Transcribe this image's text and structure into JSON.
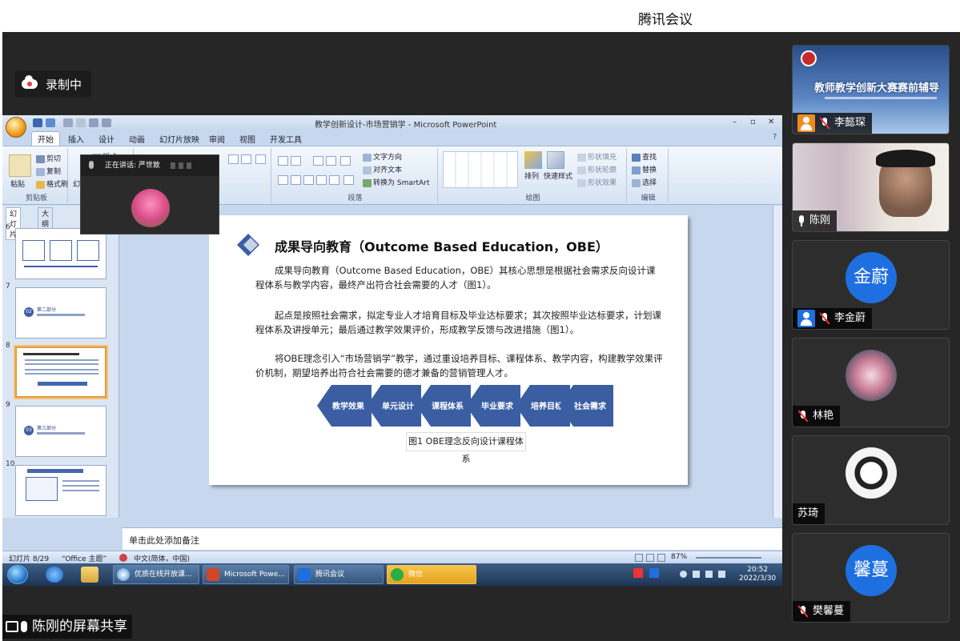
{
  "app": {
    "title": "腾讯会议"
  },
  "recording": {
    "label": "录制中"
  },
  "ppt": {
    "window_title": "教学创新设计-市场营销学 - Microsoft PowerPoint",
    "tabs": [
      "开始",
      "插入",
      "设计",
      "动画",
      "幻灯片放映",
      "审阅",
      "视图",
      "开发工具"
    ],
    "ribbon": {
      "clipboard": {
        "paste": "粘贴",
        "cut": "剪切",
        "copy": "复制",
        "format_painter": "格式刷",
        "group": "剪贴板"
      },
      "slides_btn": "幻",
      "new_slide_hint": "版式",
      "paragraph": {
        "group": "段落",
        "text_direction": "文字方向",
        "align_text": "对齐文本",
        "smartart": "转换为 SmartArt"
      },
      "drawing": {
        "group": "绘图",
        "arrange": "排列",
        "quick_styles": "快速样式",
        "shape_fill": "形状填充",
        "shape_outline": "形状轮廓",
        "shape_effects": "形状效果"
      },
      "editing": {
        "group": "编辑",
        "find": "查找",
        "replace": "替换",
        "select": "选择"
      }
    },
    "thumb_tabs": [
      "幻灯片",
      "大纲"
    ],
    "thumbnails": [
      {
        "num": "6"
      },
      {
        "num": "7",
        "circle": "02",
        "text": "第二部分"
      },
      {
        "num": "8"
      },
      {
        "num": "9",
        "circle": "03",
        "text": "第三部分"
      },
      {
        "num": "10"
      }
    ],
    "slide": {
      "heading": "成果导向教育（Outcome Based Education，OBE）",
      "para1": "成果导向教育（Outcome Based Education，OBE）其核心思想是根据社会需求反向设计课程体系与教学内容，最终产出符合社会需要的人才（图1）。",
      "para2": "起点是按照社会需求，拟定专业人才培育目标及毕业达标要求；其次按照毕业达标要求，计划课程体系及讲授单元；最后通过教学效果评价，形成教学反馈与改进措施（图1）。",
      "para3": "将OBE理念引入“市场营销学”教学，通过重设培养目标、课程体系、教学内容，构建教学效果评价机制，期望培养出符合社会需要的德才兼备的营销管理人才。",
      "arrows": [
        "教学效果",
        "单元设计",
        "课程体系",
        "毕业要求",
        "培养目标",
        "社会需求"
      ],
      "caption": "图1  OBE理念反向设计课程体系"
    },
    "notes_placeholder": "单击此处添加备注",
    "status": {
      "slide_counter": "幻灯片 8/29",
      "theme": "“Office 主题”",
      "language": "中文(简体，中国)",
      "zoom": "87%"
    }
  },
  "taskbar": {
    "items": [
      "优质在线开放课...",
      "Microsoft Powe...",
      "腾讯会议",
      "微信"
    ],
    "time": "20:52",
    "date": "2022/3/30"
  },
  "speaking": {
    "label": "正在讲话: 严世致"
  },
  "share_label": "陈刚的屏幕共享",
  "participants": [
    {
      "name": "李懿琛",
      "poster_title": "教师教学创新大赛赛前辅导"
    },
    {
      "name": "陈刚"
    },
    {
      "name": "李金蔚",
      "avatar_text": "金蔚"
    },
    {
      "name": "林艳"
    },
    {
      "name": "苏琦"
    },
    {
      "name": "樊馨蔓",
      "avatar_text": "馨蔓"
    }
  ],
  "colors": {
    "accent_blue": "#1e6fe0",
    "slide_arrow": "#3b5ea3",
    "mute_red": "#e33333",
    "panel_bg": "#262626"
  }
}
